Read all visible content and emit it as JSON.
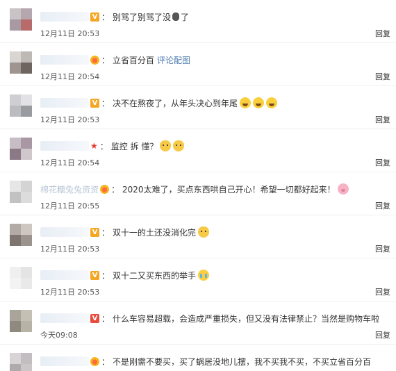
{
  "reply_label": "回复",
  "comments": [
    {
      "name": "",
      "badge": "V",
      "text": "别骂了别骂了没",
      "suffix": "了",
      "time": "12月11日 20:53"
    },
    {
      "name": "",
      "badge": "crown",
      "text": "立省百分百",
      "link": "评论配图",
      "time": "12月11日 20:54"
    },
    {
      "name": "",
      "badge": "V",
      "text": "决不在熬夜了，从年头决心到年尾",
      "time": "12月11日 20:53"
    },
    {
      "name": "",
      "badge": "star",
      "text": "监控 拆 懂？",
      "time": "12月11日 20:54"
    },
    {
      "name": "棉花糖兔兔资资",
      "badge": "crown",
      "text": "2020太难了，买点东西哄自己开心！希望一切都好起来！",
      "time": "12月11日 20:55"
    },
    {
      "name": "",
      "badge": "V",
      "text": "双十一的土还没消化完",
      "time": "12月11日 20:53"
    },
    {
      "name": "",
      "badge": "V",
      "text": "双十二又买东西的举手",
      "time": "12月11日 20:53"
    },
    {
      "name": "",
      "badge": "V-red",
      "text": "什么车容易超载，会造成严重损失，但又没有法律禁止？当然是购物车啦",
      "time": "今天09:08"
    },
    {
      "name": "",
      "badge": "crown",
      "text": "不是刚需不要买，买了蜗居没地儿摆，我不买我不买，不买立省百分百",
      "time": ""
    }
  ]
}
